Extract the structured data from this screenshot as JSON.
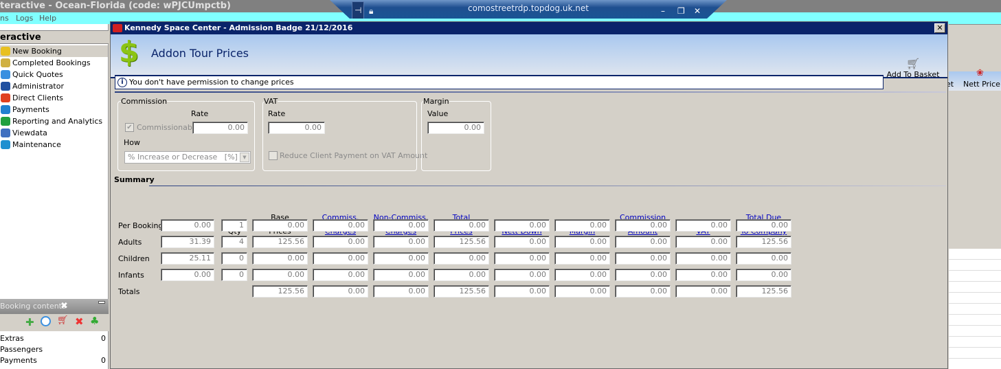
{
  "app": {
    "title": "teractive - Ocean-Florida (code: wPJCUmpctb)",
    "menu": [
      "ns",
      "Logs",
      "Help"
    ]
  },
  "rdp": {
    "host": "comostreetrdp.topdog.uk.net",
    "icons": [
      "pin-icon",
      "lock-icon",
      "minimize-icon",
      "restore-icon",
      "close-icon"
    ]
  },
  "sidebar": {
    "header": "eractive",
    "items": [
      {
        "label": "New Booking",
        "icon": "palm-tree-icon",
        "color": "#e8c020"
      },
      {
        "label": "Completed Bookings",
        "icon": "palm-tree-icon",
        "color": "#d0b040"
      },
      {
        "label": "Quick Quotes",
        "icon": "clock-icon",
        "color": "#3a90e0"
      },
      {
        "label": "Administrator",
        "icon": "runner-icon",
        "color": "#2050a0"
      },
      {
        "label": "Direct Clients",
        "icon": "people-icon",
        "color": "#e04020"
      },
      {
        "label": "Payments",
        "icon": "card-dollar-icon",
        "color": "#2080d0"
      },
      {
        "label": "Reporting and Analytics",
        "icon": "report-icon",
        "color": "#20a040"
      },
      {
        "label": "Viewdata",
        "icon": "globe-icon",
        "color": "#4070c0"
      },
      {
        "label": "Maintenance",
        "icon": "books-icon",
        "color": "#2090d0"
      }
    ]
  },
  "booking_contents": {
    "title": "Booking contents",
    "toolbar": [
      "add-icon",
      "clock-icon",
      "basket-arrow-icon",
      "delete-icon",
      "palm-tree-icon"
    ],
    "items": [
      {
        "label": "Extras",
        "value": "0"
      },
      {
        "label": "Passengers",
        "value": ""
      },
      {
        "label": "Payments",
        "value": "0"
      }
    ]
  },
  "dialog": {
    "title": "Kennedy Space Center - Admission Badge 21/12/2016",
    "heading": "Addon Tour Prices",
    "info": "You don't have permission to change prices",
    "add_to_basket": "Add To Basket",
    "commission": {
      "legend": "Commission",
      "rate_label": "Rate",
      "commissionable_label": "Commissionable",
      "commissionable_checked": true,
      "rate": "0.00",
      "how_label": "How",
      "how_value": "% Increase or Decrease   [%]"
    },
    "vat": {
      "legend": "VAT",
      "rate_label": "Rate",
      "rate": "0.00",
      "reduce_label": "Reduce Client Payment on VAT Amount",
      "reduce_checked": false
    },
    "margin": {
      "legend": "Margin",
      "value_label": "Value",
      "value": "0.00"
    },
    "summary": {
      "title": "Summary",
      "headers": [
        [
          "",
          "Qty"
        ],
        [
          "Base",
          "Prices"
        ],
        [
          "Commiss.",
          "Charges"
        ],
        [
          "Non-Commiss.",
          "Charges"
        ],
        [
          "Total",
          "Prices"
        ],
        [
          "",
          "Nett Down"
        ],
        [
          "",
          "Margin"
        ],
        [
          "Commission",
          "Amount"
        ],
        [
          "",
          "VAT"
        ],
        [
          "Total Due",
          "To Company"
        ]
      ],
      "header_links": [
        false,
        false,
        true,
        true,
        true,
        true,
        true,
        true,
        true,
        true
      ],
      "rows": [
        {
          "label": "Per Booking",
          "unit": "0.00",
          "qty": "1",
          "cells": [
            "0.00",
            "0.00",
            "0.00",
            "0.00",
            "0.00",
            "0.00",
            "0.00",
            "0.00",
            "0.00"
          ]
        },
        {
          "label": "Adults",
          "unit": "31.39",
          "qty": "4",
          "cells": [
            "125.56",
            "0.00",
            "0.00",
            "125.56",
            "0.00",
            "0.00",
            "0.00",
            "0.00",
            "125.56"
          ]
        },
        {
          "label": "Children",
          "unit": "25.11",
          "qty": "0",
          "cells": [
            "0.00",
            "0.00",
            "0.00",
            "0.00",
            "0.00",
            "0.00",
            "0.00",
            "0.00",
            "0.00"
          ]
        },
        {
          "label": "Infants",
          "unit": "0.00",
          "qty": "0",
          "cells": [
            "0.00",
            "0.00",
            "0.00",
            "0.00",
            "0.00",
            "0.00",
            "0.00",
            "0.00",
            "0.00"
          ]
        },
        {
          "label": "Totals",
          "cells": [
            "125.56",
            "0.00",
            "0.00",
            "125.56",
            "0.00",
            "0.00",
            "0.00",
            "0.00",
            "125.56"
          ]
        }
      ]
    }
  },
  "background_toolbar": {
    "partial_label": "et",
    "nett_price": "Nett Price"
  }
}
